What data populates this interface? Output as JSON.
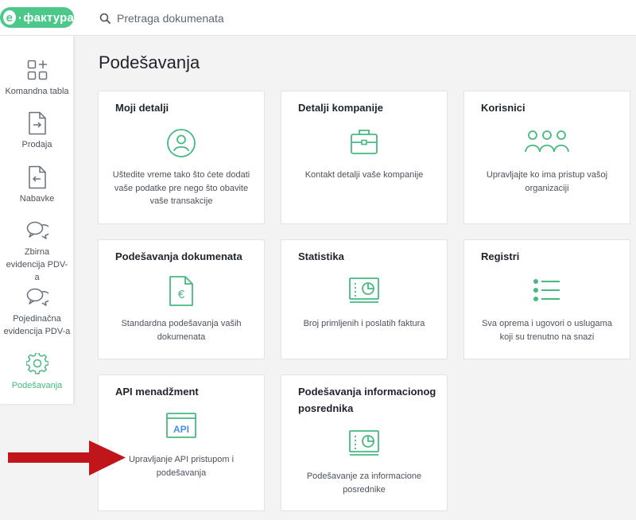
{
  "app": {
    "logo_letter": "e",
    "logo_text": "фактура"
  },
  "search": {
    "placeholder": "Pretraga dokumenata"
  },
  "sidebar": {
    "items": [
      {
        "label": "Komandna tabla",
        "icon": "dashboard-icon"
      },
      {
        "label": "Prodaja",
        "icon": "sales-doc-icon"
      },
      {
        "label": "Nabavke",
        "icon": "purchases-doc-icon"
      },
      {
        "label": "Zbirna evidencija PDV-a",
        "icon": "chat-bubbles-icon"
      },
      {
        "label": "Pojedinačna evidencija PDV-a",
        "icon": "chat-bubbles-icon"
      },
      {
        "label": "Podešavanja",
        "icon": "gear-icon",
        "active": true
      }
    ]
  },
  "page": {
    "title": "Podešavanja"
  },
  "cards": [
    {
      "title": "Moji detalji",
      "desc": "Uštedite vreme tako što ćete dodati vaše podatke pre nego što obavite vaše transakcije",
      "icon": "user-circle-icon"
    },
    {
      "title": "Detalji kompanije",
      "desc": "Kontakt detalji vaše kompanije",
      "icon": "briefcase-icon"
    },
    {
      "title": "Korisnici",
      "desc": "Upravljajte ko ima pristup vašoj organizaciji",
      "icon": "users-group-icon"
    },
    {
      "title": "Podešavanja dokumenata",
      "desc": "Standardna podešavanja vaših dokumenata",
      "icon": "euro-document-icon"
    },
    {
      "title": "Statistika",
      "desc": "Broj primljenih i poslatih faktura",
      "icon": "statistics-screen-icon"
    },
    {
      "title": "Registri",
      "desc": "Sva oprema i ugovori o uslugama koji su trenutno na snazi",
      "icon": "list-icon"
    },
    {
      "title": "API menadžment",
      "desc": "Upravljanje API pristupom i podešavanja",
      "icon": "api-window-icon",
      "icon_text": "API"
    },
    {
      "title": "Podešavanja informacionog posrednika",
      "desc": "Podešavanje za informacione posrednike",
      "icon": "statistics-screen-icon"
    }
  ],
  "colors": {
    "accent": "#4cc98a",
    "icon_green": "#46b97f",
    "api_blue": "#4a90e2",
    "arrow_red": "#c0151b"
  }
}
